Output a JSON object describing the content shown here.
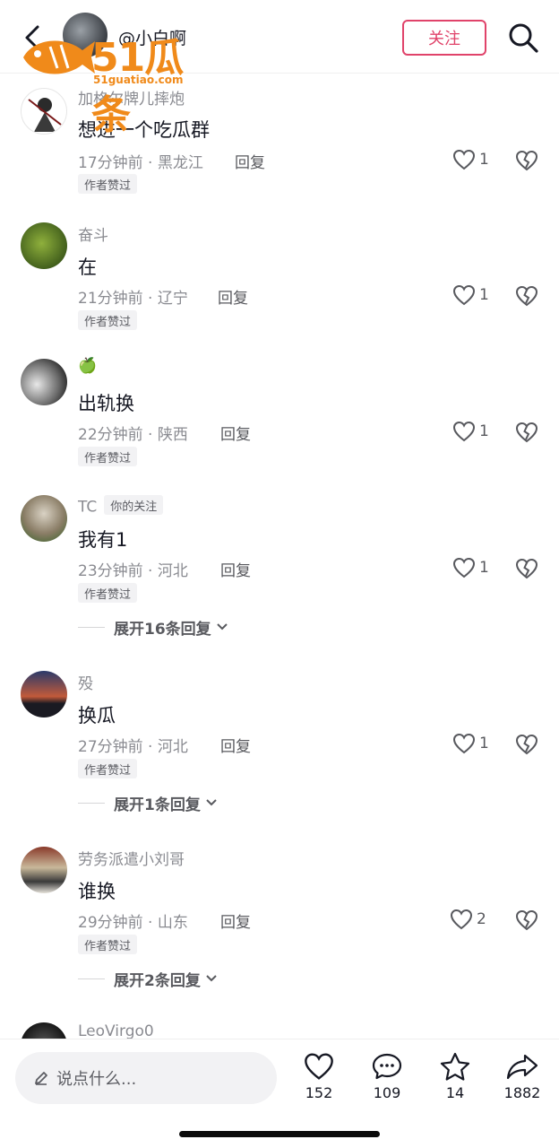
{
  "header": {
    "username": "@小白啊",
    "follow_label": "关注"
  },
  "watermark": {
    "text": "51瓜条",
    "url": "51guatiao.com"
  },
  "comments": [
    {
      "name": "加格尔牌儿摔炮",
      "text": "想进一个吃瓜群",
      "meta": "17分钟前 · 黑龙江",
      "reply": "回复",
      "likes": "1",
      "badge": "作者赞过",
      "avatar": "avatar-illustration"
    },
    {
      "name": "奋斗",
      "text": "在",
      "meta": "21分钟前 · 辽宁",
      "reply": "回复",
      "likes": "1",
      "badge": "作者赞过",
      "avatar": "avatar-green-leaves"
    },
    {
      "name": "🍏",
      "text": "出轨换",
      "meta": "22分钟前 · 陕西",
      "reply": "回复",
      "likes": "1",
      "badge": "作者赞过",
      "avatar": "avatar-bw-portrait"
    },
    {
      "name": "TC",
      "tag": "你的关注",
      "text": "我有1",
      "meta": "23分钟前 · 河北",
      "reply": "回复",
      "likes": "1",
      "badge": "作者赞过",
      "expand": "展开16条回复",
      "avatar": "avatar-cat"
    },
    {
      "name": "殁",
      "text": "换瓜",
      "meta": "27分钟前 · 河北",
      "reply": "回复",
      "likes": "1",
      "badge": "作者赞过",
      "expand": "展开1条回复",
      "avatar": "avatar-sunset"
    },
    {
      "name": "劳务派遣小刘哥",
      "text": "谁换",
      "meta": "29分钟前 · 山东",
      "reply": "回复",
      "likes": "2",
      "badge": "作者赞过",
      "expand": "展开2条回复",
      "avatar": "avatar-group-photo"
    },
    {
      "name": "LeoVirgo0",
      "avatar": "avatar-dark"
    }
  ],
  "bottom": {
    "placeholder": "说点什么...",
    "likes": "152",
    "comments": "109",
    "favorites": "14",
    "shares": "1882"
  },
  "colors": {
    "accent": "#e0436a",
    "watermark": "#f08a1a",
    "muted_text": "#8a8b91"
  }
}
